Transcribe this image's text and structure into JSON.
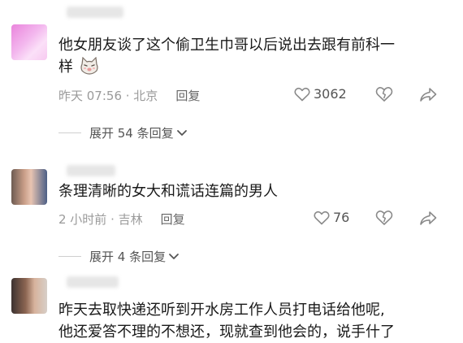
{
  "comments": [
    {
      "text_line1": "他女朋友谈了这个偷卫生巾哥以后说出去跟有前科一",
      "text_line2": "样",
      "emoji": "cat-face-icon",
      "time": "昨天 07:56 · 北京",
      "reply": "回复",
      "likes": "3062",
      "expand": "展开 54 条回复"
    },
    {
      "text_line1": "条理清晰的女大和谎话连篇的男人",
      "time": "2 小时前 · 吉林",
      "reply": "回复",
      "likes": "76",
      "expand": "展开 4 条回复"
    },
    {
      "text_line1": "昨天去取快递还听到开水房工作人员打电话给他呢,",
      "text_line2": "他还爱答不理的不想还，现就查到他会的，说手什了"
    }
  ],
  "colors": {
    "text": "#1a1a1a",
    "meta": "#9a9a9a",
    "icon": "#8a8a8a"
  }
}
